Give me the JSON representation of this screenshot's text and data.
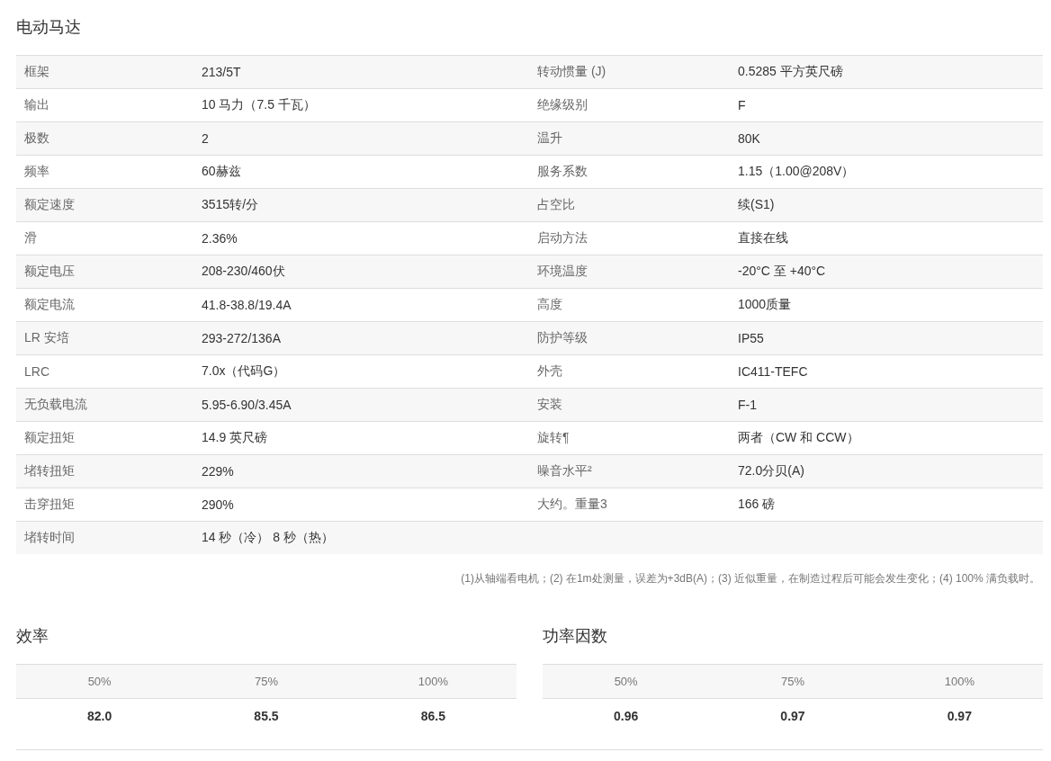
{
  "title": "电动马达",
  "specs": [
    {
      "label": "框架",
      "value": "213/5T",
      "label_2": "转动惯量 (J)",
      "value_2": "0.5285 平方英尺磅"
    },
    {
      "label": "输出",
      "value": "10 马力（7.5 千瓦）",
      "label_2": "绝缘级别",
      "value_2": "F"
    },
    {
      "label": "极数",
      "value": "2",
      "label_2": "温升",
      "value_2": "80K"
    },
    {
      "label": "频率",
      "value": "60赫兹",
      "label_2": "服务系数",
      "value_2": "1.15（1.00@208V）"
    },
    {
      "label": "额定速度",
      "value": "3515转/分",
      "label_2": "占空比",
      "value_2": "续(S1)"
    },
    {
      "label": "滑",
      "value": "2.36%",
      "label_2": "启动方法",
      "value_2": "直接在线"
    },
    {
      "label": "额定电压",
      "value": "208-230/460伏",
      "label_2": "环境温度",
      "value_2": "-20°C 至 +40°C"
    },
    {
      "label": "额定电流",
      "value": "41.8-38.8/19.4A",
      "label_2": "高度",
      "value_2": "1000质量"
    },
    {
      "label": "LR 安培",
      "value": "293-272/136A",
      "label_2": "防护等级",
      "value_2": "IP55"
    },
    {
      "label": "LRC",
      "value": "7.0x（代码G）",
      "label_2": "外壳",
      "value_2": "IC411-TEFC"
    },
    {
      "label": "无负载电流",
      "value": "5.95-6.90/3.45A",
      "label_2": "安装",
      "value_2": "F-1"
    },
    {
      "label": "额定扭矩",
      "value": "14.9 英尺磅",
      "label_2": "旋转¶",
      "value_2": "两者（CW 和 CCW）"
    },
    {
      "label": "堵转扭矩",
      "value": "229%",
      "label_2": "噪音水平²",
      "value_2": "72.0分贝(A)"
    },
    {
      "label": "击穿扭矩",
      "value": "290%",
      "label_2": "大约。重量3",
      "value_2": "166 磅"
    },
    {
      "label": "堵转时间",
      "value": "14 秒（冷） 8 秒（热）"
    }
  ],
  "footnote": "(1)从轴端看电机；(2) 在1m处测量，误差为+3dB(A)；(3) 近似重量，在制造过程后可能会发生变化；(4) 100% 满负载时。",
  "load_tables": [
    {
      "title": "效率",
      "columns": [
        "50%",
        "75%",
        "100%"
      ],
      "values": [
        "82.0",
        "85.5",
        "86.5"
      ]
    },
    {
      "title": "功率因数",
      "columns": [
        "50%",
        "75%",
        "100%"
      ],
      "values": [
        "0.96",
        "0.97",
        "0.97"
      ]
    }
  ]
}
